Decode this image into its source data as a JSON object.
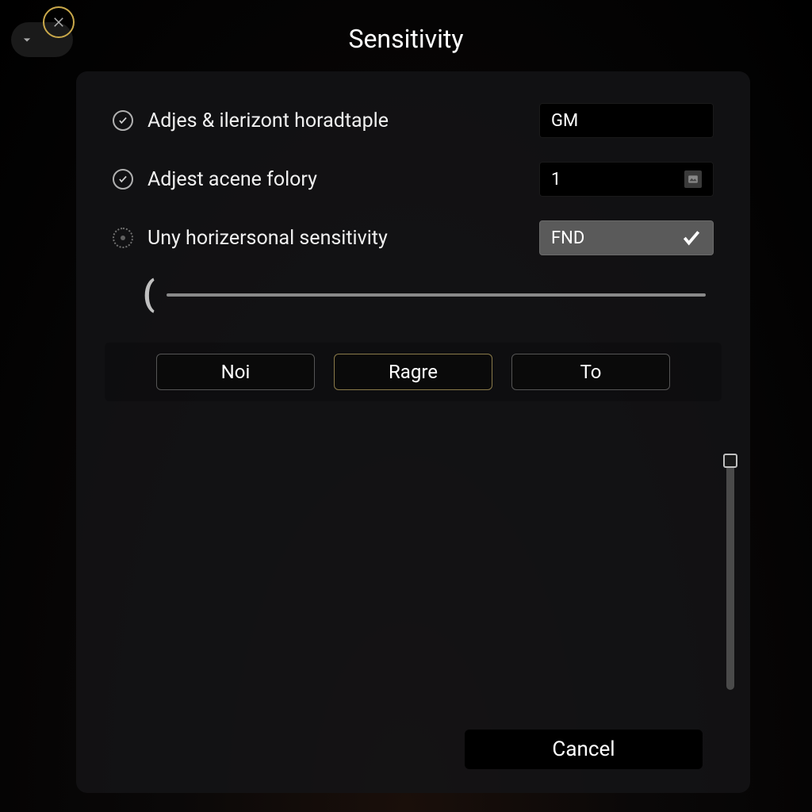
{
  "title": "Sensitivity",
  "options": [
    {
      "label": "Adjes & ilerizont horadtaple",
      "value": "GM",
      "checked": true,
      "type": "text"
    },
    {
      "label": "Adjest acene folory",
      "value": "1",
      "checked": true,
      "type": "stepper"
    },
    {
      "label": "Uny horizersonal sensitivity",
      "value": "FND",
      "checked": false,
      "type": "toggle",
      "toggle_on": true
    }
  ],
  "slider": {
    "value": 0,
    "min": 0,
    "max": 100
  },
  "buttons": {
    "btn1": "Noi",
    "btn2": "Ragre",
    "btn3": "To"
  },
  "cancel": "Cancel"
}
